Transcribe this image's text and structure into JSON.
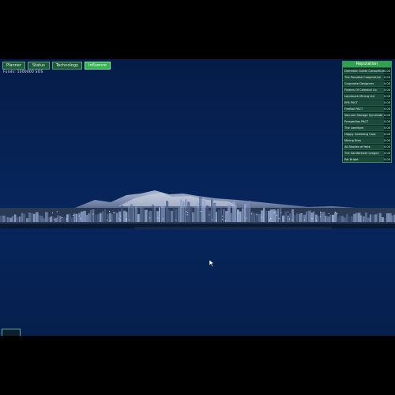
{
  "tabs": [
    {
      "label": "Planner",
      "active": false
    },
    {
      "label": "Status",
      "active": false
    },
    {
      "label": "Technology",
      "active": false
    },
    {
      "label": "Influence",
      "active": true
    }
  ],
  "funds": "Funds: 1000000 SOS",
  "reputation": {
    "title": "Reputation",
    "rows": [
      {
        "name": "Domestic Guilds Consortium",
        "value": "0.00"
      },
      {
        "name": "The Paradise Cooperative",
        "value": "0.00"
      },
      {
        "name": "Corporate Designers",
        "value": "0.00"
      },
      {
        "name": "Finders Of Celestial Co.",
        "value": "0.00"
      },
      {
        "name": "Landmark Mining Ltd",
        "value": "0.00"
      },
      {
        "name": "EPA PACT",
        "value": "0.00"
      },
      {
        "name": "FireBall PACT",
        "value": "0.00"
      },
      {
        "name": "Vacuum Storage Syndicate",
        "value": "0.00"
      },
      {
        "name": "Prosperitas PACT",
        "value": "0.00"
      },
      {
        "name": "The Landfunk",
        "value": "0.00"
      },
      {
        "name": "Happy Gambling Corp",
        "value": "0.00"
      },
      {
        "name": "Mining Bros",
        "value": "0.00"
      },
      {
        "name": "All Shades of Hats",
        "value": "0.00"
      },
      {
        "name": "The Sandbrewer League",
        "value": "0.00"
      },
      {
        "name": "Pat Bright",
        "value": "0.00"
      }
    ]
  },
  "corner_button": "",
  "colors": {
    "sky": "#062152",
    "accent": "#2fa24b"
  },
  "icons": {
    "cursor": "mouse-pointer-icon"
  }
}
